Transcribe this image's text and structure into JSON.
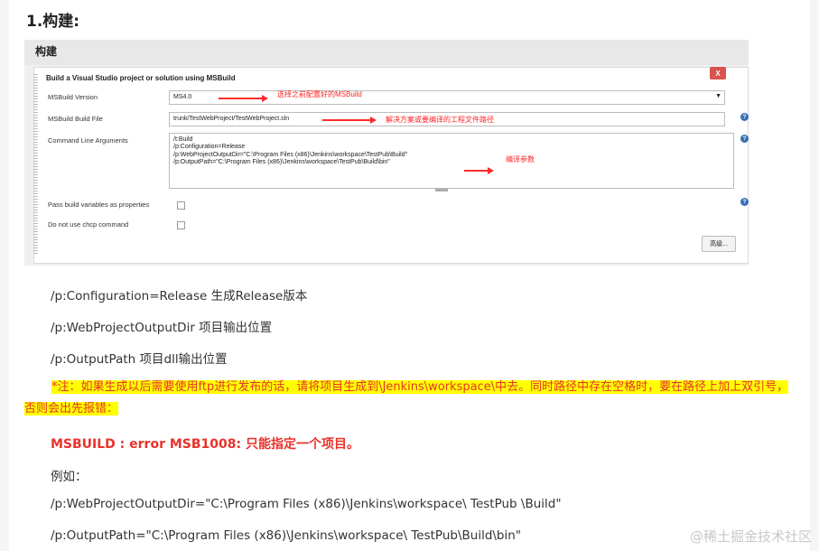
{
  "section_title": "1.构建:",
  "jenkins": {
    "section_header": "构建",
    "step_title": "Build a Visual Studio project or solution using MSBuild",
    "delete_label": "X",
    "fields": {
      "msbuild_version_label": "MSBuild Version",
      "msbuild_version_value": "MS4.0",
      "build_file_label": "MSBuild Build File",
      "build_file_value": "trunk/TestWebProject/TestWebProject.sln",
      "cmd_args_label": "Command Line Arguments",
      "cmd_args_lines": [
        "/t:Build",
        "/p:Configuration=Release",
        "/p:WebProjectOutputDir=\"C:\\Program Files (x86)\\Jenkins\\workspace\\TestPub\\Build\"",
        "/p:OutputPath=\"C:\\Program Files (x86)\\Jenkins\\workspace\\TestPub\\Build\\bin\""
      ],
      "pass_vars_label": "Pass build variables as properties",
      "no_chcp_label": "Do not use chcp command"
    },
    "advanced_label": "高级...",
    "help_glyph": "?",
    "annotations": {
      "version": "选择之前配置好的MSBuild",
      "build_file": "解决方案或要编译的工程文件路径",
      "args": "编译参数"
    }
  },
  "paragraphs": {
    "p1": "/p:Configuration=Release    生成Release版本",
    "p2": "/p:WebProjectOutputDir   项目输出位置",
    "p3": "/p:OutputPath     项目dll输出位置"
  },
  "note": {
    "text": "*注：如果生成以后需要使用ftp进行发布的话，请将项目生成到\\Jenkins\\workspace\\中去。同时路径中存在空格时，要在路径上加上双引号，否则会出先报错："
  },
  "error_line": "MSBUILD : error MSB1008: 只能指定一个项目。",
  "example_label": "例如：",
  "example1": "/p:WebProjectOutputDir=\"C:\\Program Files (x86)\\Jenkins\\workspace\\ TestPub \\Build\"",
  "example2": "/p:OutputPath=\"C:\\Program Files (x86)\\Jenkins\\workspace\\ TestPub\\Build\\bin\"",
  "watermark": "@稀土掘金技术社区",
  "colors": {
    "accent_red": "#e8322a",
    "highlight": "#ffff00",
    "annotation_red": "#ff2a2a"
  }
}
